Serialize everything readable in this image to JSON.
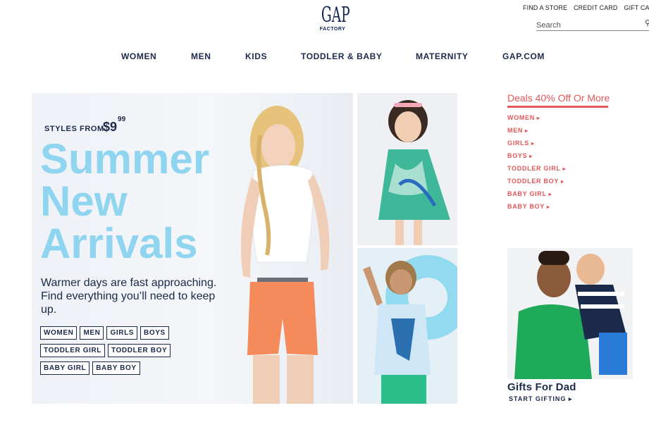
{
  "utility": {
    "find_store": "FIND A STORE",
    "credit_card": "CREDIT CARD",
    "gift_card": "GIFT CA"
  },
  "search": {
    "placeholder": "Search",
    "icon": "search-icon"
  },
  "logo": {
    "brand": "GAP",
    "sub": "FACTORY"
  },
  "nav": [
    "WOMEN",
    "MEN",
    "KIDS",
    "TODDLER & BABY",
    "MATERNITY",
    "GAP.COM"
  ],
  "hero": {
    "styles_from": "STYLES FROM",
    "price_dollars": "$9",
    "price_cents": "99",
    "headline": [
      "Summer",
      "New",
      "Arrivals"
    ],
    "blurb": "Warmer days are fast approaching. Find everything you’ll need to keep up.",
    "categories": [
      "WOMEN",
      "MEN",
      "GIRLS",
      "BOYS",
      "TODDLER GIRL",
      "TODDLER BOY",
      "BABY GIRL",
      "BABY BOY"
    ]
  },
  "deals": {
    "title": "Deals 40% Off Or More",
    "items": [
      "WOMEN",
      "MEN",
      "GIRLS",
      "BOYS",
      "TODDLER GIRL",
      "TODDLER BOY",
      "BABY GIRL",
      "BABY BOY"
    ]
  },
  "gifts": {
    "title": "Gifts For Dad",
    "link": "START GIFTING ▸"
  },
  "colors": {
    "navy": "#1b2a4a",
    "headline_blue": "#8fd5f0",
    "deals_red": "#e2585a"
  }
}
